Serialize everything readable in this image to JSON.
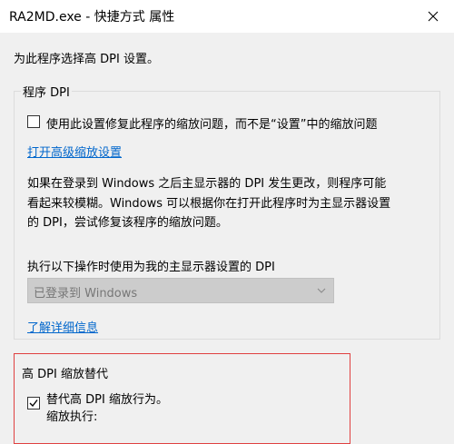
{
  "window": {
    "title": "RA2MD.exe - 快捷方式 属性"
  },
  "intro_text": "为此程序选择高 DPI 设置。",
  "program_dpi": {
    "group_title": "程序 DPI",
    "checkbox_label": "使用此设置修复此程序的缩放问题，而不是“设置”中的缩放问题",
    "checkbox_checked": false,
    "advanced_link": "打开高级缩放设置",
    "description_lines": [
      "如果在登录到 Windows 之后主显示器的 DPI 发生更改，则程序可能",
      "看起来较模糊。Windows 可以根据你在打开此程序时为主显示器设置",
      "的 DPI，尝试修复该程序的缩放问题。"
    ],
    "exec_label": "执行以下操作时使用为我的主显示器设置的 DPI",
    "dropdown_value": "已登录到 Windows",
    "learn_more_link": "了解详细信息"
  },
  "dpi_override": {
    "group_title": "高 DPI 缩放替代",
    "checkbox_label": "替代高 DPI 缩放行为。",
    "checkbox_checked": true,
    "scaling_label": "缩放执行:"
  },
  "colors": {
    "link": "#0066cc",
    "highlight_border": "#e04040",
    "window_bg": "#f0f0f0"
  },
  "icons": {
    "close": "close-icon",
    "dropdown": "chevron-down-icon",
    "check": "checkmark-icon"
  }
}
